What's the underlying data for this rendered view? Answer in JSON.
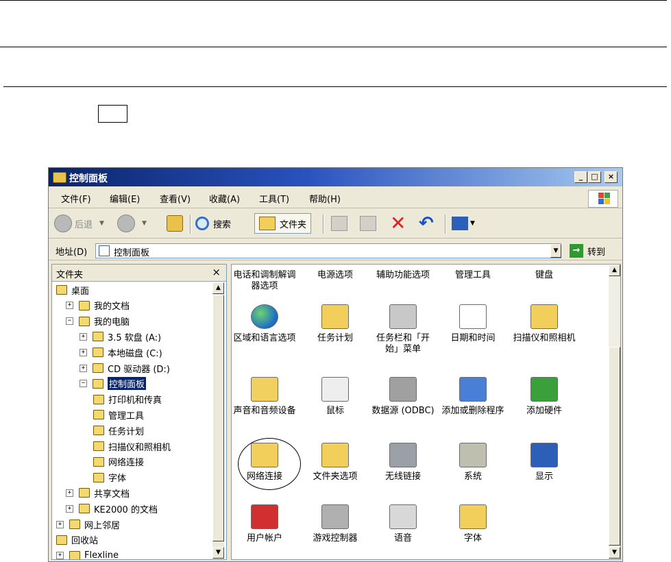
{
  "window": {
    "title": "控制面板",
    "buttons": [
      "_",
      "□",
      "×"
    ]
  },
  "menu": [
    {
      "label": "文件(F)"
    },
    {
      "label": "编辑(E)"
    },
    {
      "label": "查看(V)"
    },
    {
      "label": "收藏(A)"
    },
    {
      "label": "工具(T)"
    },
    {
      "label": "帮助(H)"
    }
  ],
  "toolbar": {
    "back_label": "后退",
    "search_label": "搜索",
    "folders_label": "文件夹"
  },
  "address": {
    "label": "地址(D)",
    "value": "控制面板",
    "go_label": "转到"
  },
  "folders_pane": {
    "title": "文件夹",
    "close": "×",
    "tree": [
      {
        "label": "桌面",
        "level": 0,
        "expander": ""
      },
      {
        "label": "我的文档",
        "level": 1,
        "expander": "+"
      },
      {
        "label": "我的电脑",
        "level": 1,
        "expander": "−"
      },
      {
        "label": "3.5 软盘 (A:)",
        "level": 2,
        "expander": "+"
      },
      {
        "label": "本地磁盘 (C:)",
        "level": 2,
        "expander": "+"
      },
      {
        "label": "CD 驱动器 (D:)",
        "level": 2,
        "expander": "+"
      },
      {
        "label": "控制面板",
        "level": 2,
        "expander": "−",
        "selected": true
      },
      {
        "label": "打印机和传真",
        "level": 3,
        "expander": ""
      },
      {
        "label": "管理工具",
        "level": 3,
        "expander": ""
      },
      {
        "label": "任务计划",
        "level": 3,
        "expander": ""
      },
      {
        "label": "扫描仪和照相机",
        "level": 3,
        "expander": ""
      },
      {
        "label": "网络连接",
        "level": 3,
        "expander": ""
      },
      {
        "label": "字体",
        "level": 3,
        "expander": ""
      },
      {
        "label": "共享文档",
        "level": 1,
        "expander": "+"
      },
      {
        "label": "KE2000 的文档",
        "level": 1,
        "expander": "+"
      },
      {
        "label": "网上邻居",
        "level": 0,
        "expander": "+"
      },
      {
        "label": "回收站",
        "level": 0,
        "expander": ""
      },
      {
        "label": "Flexline",
        "level": 0,
        "expander": "+"
      }
    ]
  },
  "items": [
    {
      "label": "电话和调制解调器选项",
      "icon": "none"
    },
    {
      "label": "电源选项",
      "icon": "none"
    },
    {
      "label": "辅助功能选项",
      "icon": "none"
    },
    {
      "label": "管理工具",
      "icon": "none"
    },
    {
      "label": "键盘",
      "icon": "none"
    },
    {
      "label": "区域和语言选项",
      "icon": "globe-icon"
    },
    {
      "label": "任务计划",
      "icon": "task-folder-icon"
    },
    {
      "label": "任务栏和「开始」菜单",
      "icon": "taskbar-icon"
    },
    {
      "label": "日期和时间",
      "icon": "calendar-clock-icon"
    },
    {
      "label": "扫描仪和照相机",
      "icon": "scanner-folder-icon"
    },
    {
      "label": "声音和音频设备",
      "icon": "speaker-icon"
    },
    {
      "label": "鼠标",
      "icon": "mouse-icon"
    },
    {
      "label": "数据源 (ODBC)",
      "icon": "database-icon"
    },
    {
      "label": "添加或删除程序",
      "icon": "add-remove-icon"
    },
    {
      "label": "添加硬件",
      "icon": "hardware-icon"
    },
    {
      "label": "网络连接",
      "icon": "network-folder-icon"
    },
    {
      "label": "文件夹选项",
      "icon": "folder-options-icon"
    },
    {
      "label": "无线链接",
      "icon": "wireless-icon"
    },
    {
      "label": "系统",
      "icon": "computer-icon"
    },
    {
      "label": "显示",
      "icon": "display-icon"
    },
    {
      "label": "用户帐户",
      "icon": "users-icon"
    },
    {
      "label": "游戏控制器",
      "icon": "joystick-icon"
    },
    {
      "label": "语音",
      "icon": "speech-icon"
    },
    {
      "label": "字体",
      "icon": "fonts-folder-icon"
    }
  ],
  "colors": {
    "titlebar_start": "#0a246a",
    "titlebar_end": "#a6caf0",
    "chrome": "#ece9d8",
    "selection": "#0a246a"
  }
}
